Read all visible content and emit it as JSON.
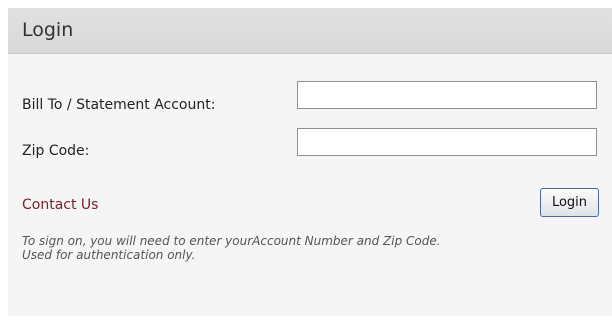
{
  "login_panel": {
    "title": "Login",
    "fields": {
      "account": {
        "label": "Bill To / Statement Account:",
        "value": "",
        "placeholder": ""
      },
      "zip": {
        "label": "Zip Code:",
        "value": "",
        "placeholder": ""
      }
    },
    "contact_link": "Contact Us",
    "login_button": "Login",
    "help_text": [
      "To sign on, you will need to enter yourAccount Number and Zip Code.",
      "Used for authentication only."
    ]
  },
  "colors": {
    "panel_background": "#f5f5f5",
    "header_background": "#dcdcdc",
    "link": "#7a1f2b",
    "button_border": "#4a6a9a"
  }
}
